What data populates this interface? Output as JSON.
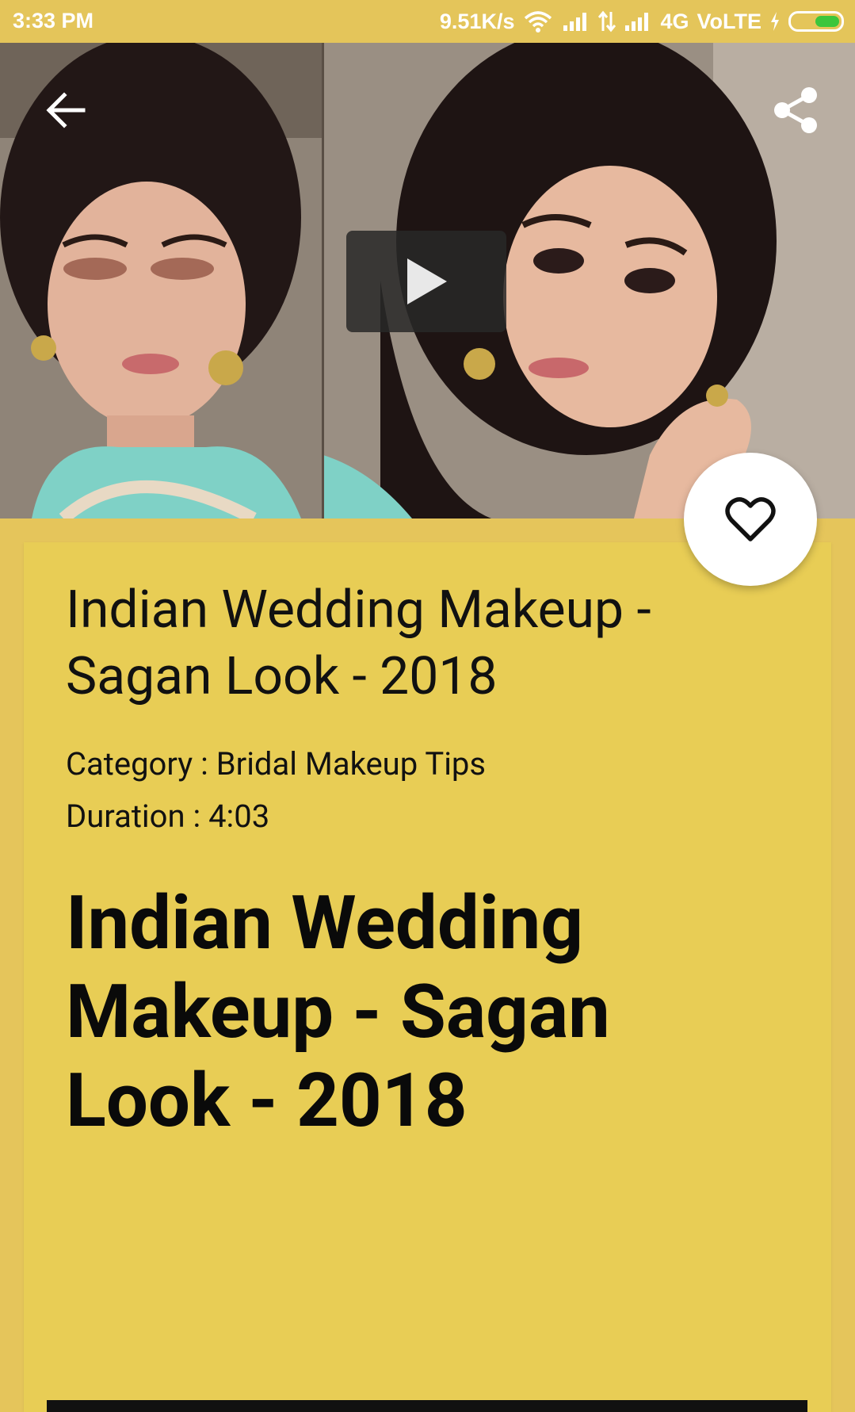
{
  "status_bar": {
    "time": "3:33 PM",
    "speed": "9.51K/s",
    "network": "4G",
    "volte": "VoLTE",
    "icons": [
      "wifi-icon",
      "signal-icon",
      "data-arrows-icon",
      "signal-icon",
      "charging-icon",
      "battery-icon"
    ]
  },
  "video": {
    "icons": {
      "back": "arrow-left-icon",
      "share": "share-icon",
      "play": "play-icon"
    }
  },
  "favorite": {
    "icon": "heart-outline-icon"
  },
  "details": {
    "title": "Indian Wedding Makeup - Sagan Look - 2018",
    "category": "Category : Bridal Makeup Tips",
    "duration": "Duration : 4:03",
    "heading": "Indian Wedding Makeup - Sagan Look - 2018"
  },
  "colors": {
    "background": "#e5c55b",
    "card": "#e8cd55",
    "text": "#111111",
    "battery": "#3cc63c"
  }
}
